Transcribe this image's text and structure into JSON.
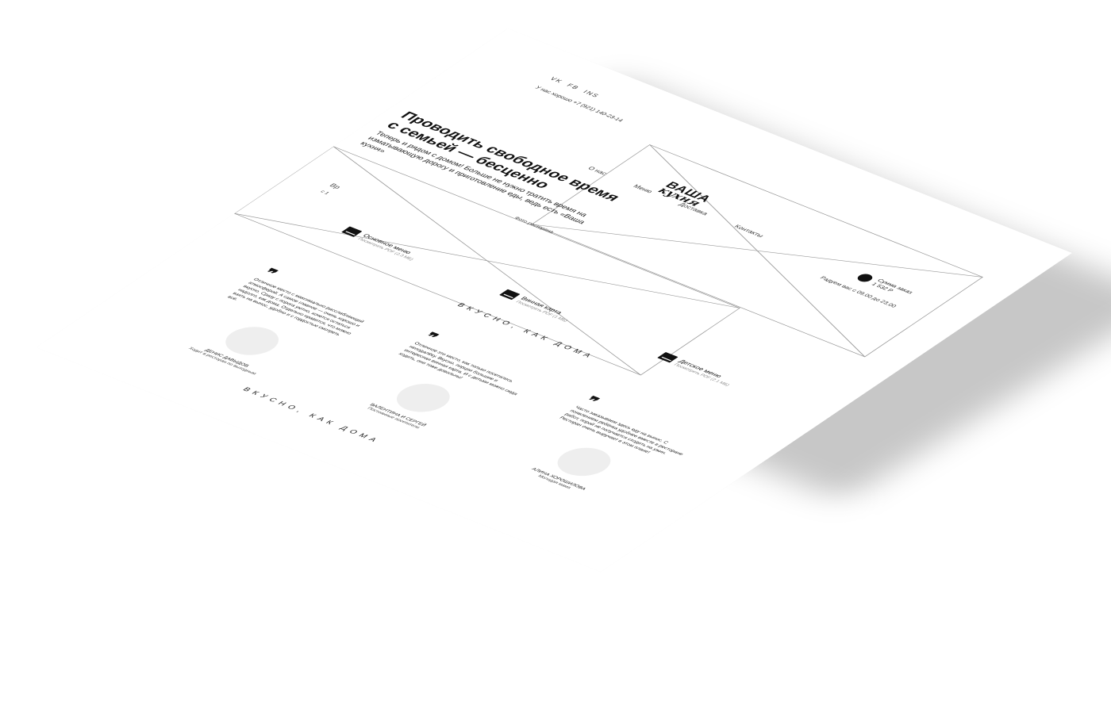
{
  "header": {
    "social": [
      "VK",
      "FB",
      "INS"
    ],
    "phone": "У нас хорошо +7 (921) 140-23-14",
    "logo_top": "ВАША",
    "logo_bottom": "кухня",
    "nav": [
      "О нас",
      "Меню",
      "Доставка",
      "Контакты"
    ],
    "cart_label": "Сумма заказ",
    "cart_amount": "1 532 Р",
    "hours": "Радуем вас с 09.00 до 23.00"
  },
  "hero": {
    "title": "Проводить свободное время с семьей — бесценно",
    "subtitle": "Теперь и рядом с домом! Больше не нужно тратить время на изматывающую дорогу и приготовление еды, ведь есть «Ваша кухня»",
    "photo_label": "Фото ресторана"
  },
  "fragments": {
    "f1": "Вр",
    "f2": "с 1"
  },
  "menus": [
    {
      "title": "Основное меню",
      "link": "Посмотреть PDF (2.3 МБ)"
    },
    {
      "title": "Винная карта",
      "link": "Посмотреть PDF (1 МБ)"
    },
    {
      "title": "Детское меню",
      "link": "Посмотреть PDF (2.1 МБ)"
    }
  ],
  "tagline": "ВКУСНО, КАК ДОМА",
  "reviews": [
    {
      "quote": "❞",
      "text": "Отличное место с максимально расслабляющей атмосферой. А самое главное — очень хорошо и вкусно. Сразу с порога уютно, хочется остаться надолго, как дома. Отдельно нравится, что можно взять на вынос, удобно и с гордостью смотреть всё.",
      "name": "Денис Давыдов",
      "role": "Ходит в ресторан по выходным"
    },
    {
      "quote": "❞",
      "text": "Отличное это место, как только посетились неподалёку. Вкусно, порции большие и интересная винная карта. И с детьми можно сюда ходить, они тоже довольны!",
      "name": "Валентина и Сергей",
      "role": "Постоянные посетители"
    },
    {
      "quote": "❞",
      "text": "Часто заказываем здесь еду на вынос. С появлением ребёнка удобнее вместе в ресторане работ, порой не получается сходить на ужин. Ресторан очень выручает в этом плане!",
      "name": "Алина Хорошилова",
      "role": "Молодая мама"
    }
  ],
  "colors": {
    "text": "#111111",
    "placeholder_line": "#9a9a9a",
    "avatar": "#eeeeee"
  }
}
